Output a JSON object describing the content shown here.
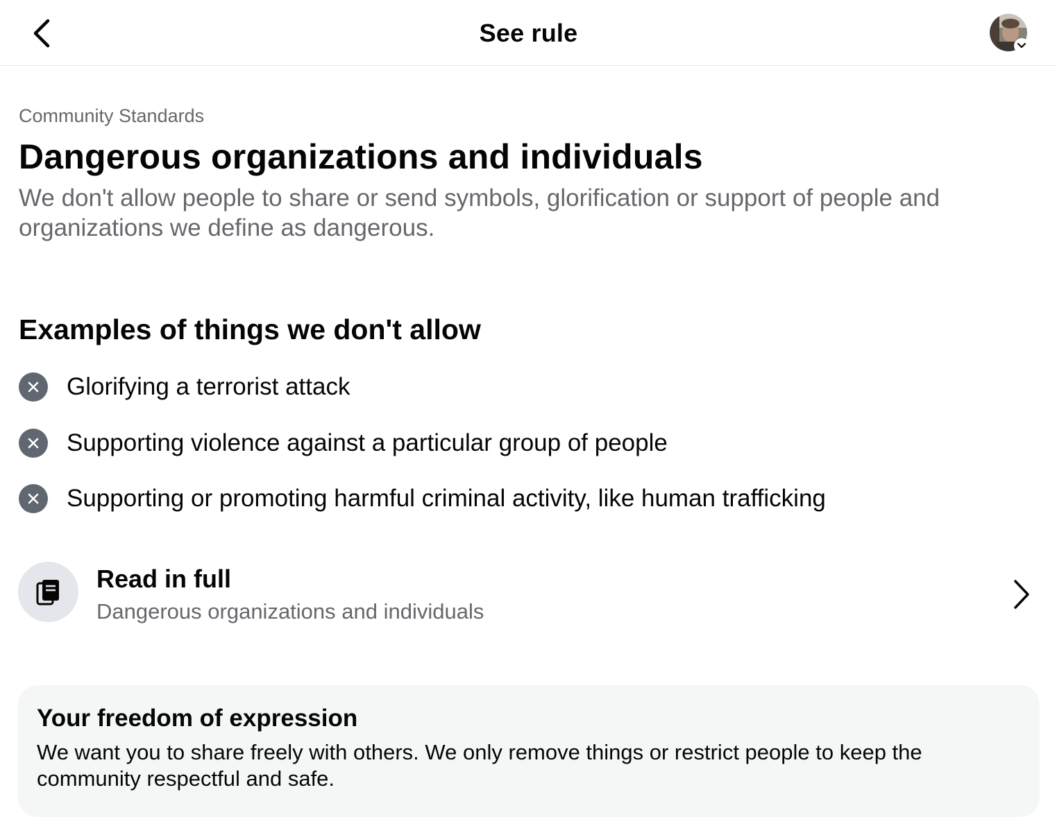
{
  "header": {
    "title": "See rule",
    "back_icon": "chevron-left-icon",
    "avatar_icon": "profile-avatar",
    "avatar_menu_icon": "chevron-down-icon"
  },
  "rule": {
    "section_label": "Community Standards",
    "title": "Dangerous organizations and individuals",
    "description": "We don't allow people to share or send symbols, glorification or support of people and organizations we define as dangerous."
  },
  "examples": {
    "heading": "Examples of things we don't allow",
    "icon": "x-circle-icon",
    "items": [
      "Glorifying a terrorist attack",
      "Supporting violence against a particular group of people",
      "Supporting or promoting harmful criminal activity, like human trafficking"
    ]
  },
  "read_full": {
    "icon": "book-icon",
    "title": "Read in full",
    "subtitle": "Dangerous organizations and individuals",
    "chevron_icon": "chevron-right-icon"
  },
  "freedom": {
    "title": "Your freedom of expression",
    "body": "We want you to share freely with others. We only remove things or restrict people to keep the community respectful and safe."
  },
  "colors": {
    "primary_text": "#050505",
    "secondary_text": "#65676b",
    "x_icon_bg": "#606770",
    "card_bg": "#f5f7f7",
    "circle_bg": "#e4e6eb"
  }
}
